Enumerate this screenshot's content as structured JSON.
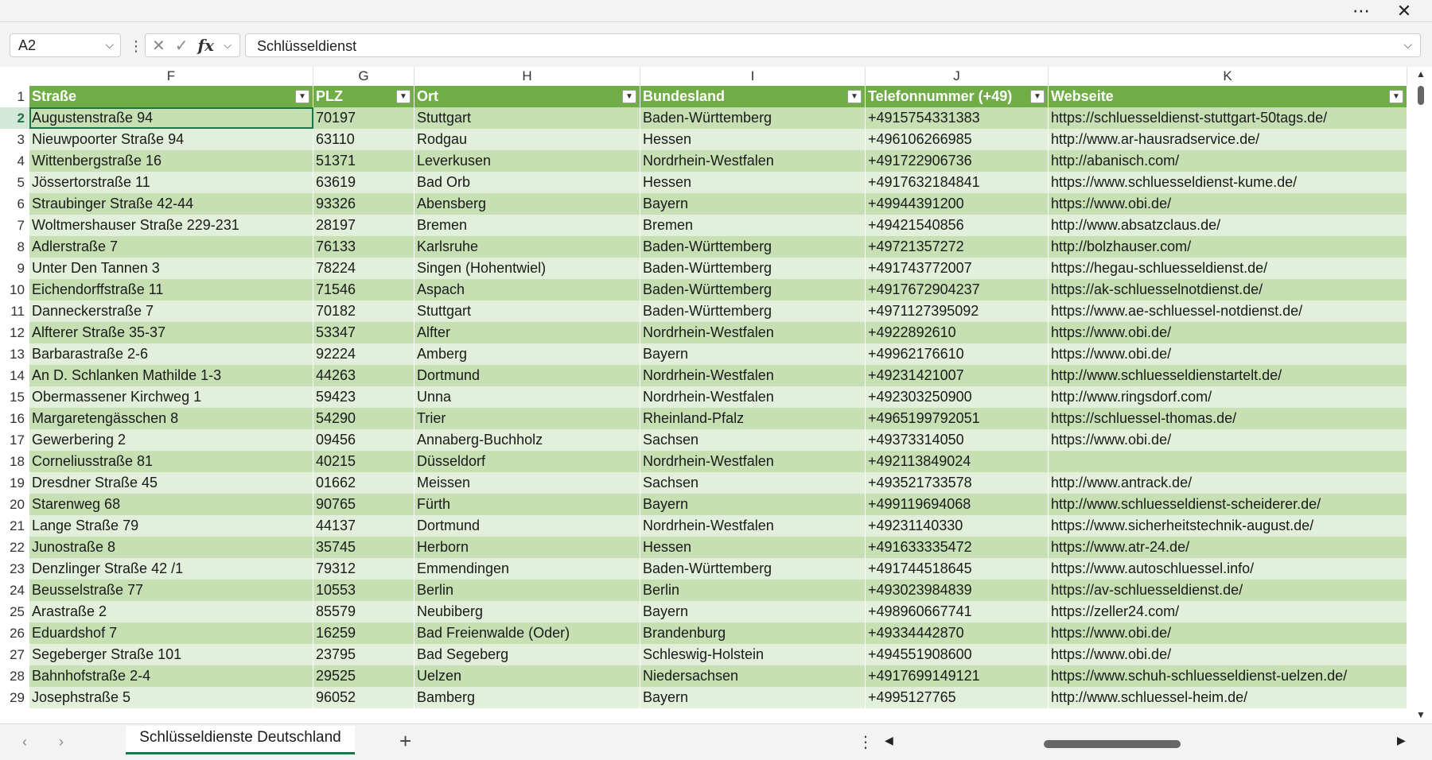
{
  "window": {
    "more_icon": "more-horizontal-icon",
    "close_icon": "close-icon"
  },
  "formula_bar": {
    "name_box": "A2",
    "formula_value": "Schlüsseldienst",
    "fx_label": "fx"
  },
  "columns": [
    "F",
    "G",
    "H",
    "I",
    "J",
    "K"
  ],
  "header_row_number": "1",
  "headers": [
    "Straße",
    "PLZ",
    "Ort",
    "Bundesland",
    "Telefonnummer (+49)",
    "Webseite"
  ],
  "rows": [
    {
      "n": "2",
      "cells": [
        "Augustenstraße 94",
        "70197",
        "Stuttgart",
        "Baden-Württemberg",
        "+4915754331383",
        "https://schluesseldienst-stuttgart-50tags.de/"
      ]
    },
    {
      "n": "3",
      "cells": [
        "Nieuwpoorter Straße 94",
        "63110",
        "Rodgau",
        "Hessen",
        "+496106266985",
        "http://www.ar-hausradservice.de/"
      ]
    },
    {
      "n": "4",
      "cells": [
        "Wittenbergstraße 16",
        "51371",
        "Leverkusen",
        "Nordrhein-Westfalen",
        "+491722906736",
        "http://abanisch.com/"
      ]
    },
    {
      "n": "5",
      "cells": [
        "Jössertorstraße 11",
        "63619",
        "Bad Orb",
        "Hessen",
        "+4917632184841",
        "https://www.schluesseldienst-kume.de/"
      ]
    },
    {
      "n": "6",
      "cells": [
        "Straubinger Straße 42-44",
        "93326",
        "Abensberg",
        "Bayern",
        "+49944391200",
        "https://www.obi.de/"
      ]
    },
    {
      "n": "7",
      "cells": [
        "Woltmershauser Straße 229-231",
        "28197",
        "Bremen",
        "Bremen",
        "+49421540856",
        "http://www.absatzclaus.de/"
      ]
    },
    {
      "n": "8",
      "cells": [
        "Adlerstraße 7",
        "76133",
        "Karlsruhe",
        "Baden-Württemberg",
        "+49721357272",
        "http://bolzhauser.com/"
      ]
    },
    {
      "n": "9",
      "cells": [
        "Unter Den Tannen 3",
        "78224",
        "Singen (Hohentwiel)",
        "Baden-Württemberg",
        "+491743772007",
        "https://hegau-schluesseldienst.de/"
      ]
    },
    {
      "n": "10",
      "cells": [
        "Eichendorffstraße 11",
        "71546",
        "Aspach",
        "Baden-Württemberg",
        "+4917672904237",
        "https://ak-schluesselnotdienst.de/"
      ]
    },
    {
      "n": "11",
      "cells": [
        "Danneckerstraße 7",
        "70182",
        "Stuttgart",
        "Baden-Württemberg",
        "+4971127395092",
        "https://www.ae-schluessel-notdienst.de/"
      ]
    },
    {
      "n": "12",
      "cells": [
        "Alfterer Straße 35-37",
        "53347",
        "Alfter",
        "Nordrhein-Westfalen",
        "+4922892610",
        "https://www.obi.de/"
      ]
    },
    {
      "n": "13",
      "cells": [
        "Barbarastraße 2-6",
        "92224",
        "Amberg",
        "Bayern",
        "+49962176610",
        "https://www.obi.de/"
      ]
    },
    {
      "n": "14",
      "cells": [
        "An D. Schlanken Mathilde 1-3",
        "44263",
        "Dortmund",
        "Nordrhein-Westfalen",
        "+49231421007",
        "http://www.schluesseldienstartelt.de/"
      ]
    },
    {
      "n": "15",
      "cells": [
        "Obermassener Kirchweg 1",
        "59423",
        "Unna",
        "Nordrhein-Westfalen",
        "+492303250900",
        "http://www.ringsdorf.com/"
      ]
    },
    {
      "n": "16",
      "cells": [
        "Margaretengässchen 8",
        "54290",
        "Trier",
        "Rheinland-Pfalz",
        "+4965199792051",
        "https://schluessel-thomas.de/"
      ]
    },
    {
      "n": "17",
      "cells": [
        "Gewerbering 2",
        "09456",
        "Annaberg-Buchholz",
        "Sachsen",
        "+49373314050",
        "https://www.obi.de/"
      ]
    },
    {
      "n": "18",
      "cells": [
        "Corneliusstraße 81",
        "40215",
        "Düsseldorf",
        "Nordrhein-Westfalen",
        "+492113849024",
        ""
      ]
    },
    {
      "n": "19",
      "cells": [
        "Dresdner Straße 45",
        "01662",
        "Meissen",
        "Sachsen",
        "+493521733578",
        "http://www.antrack.de/"
      ]
    },
    {
      "n": "20",
      "cells": [
        "Starenweg 68",
        "90765",
        "Fürth",
        "Bayern",
        "+499119694068",
        "http://www.schluesseldienst-scheiderer.de/"
      ]
    },
    {
      "n": "21",
      "cells": [
        "Lange Straße 79",
        "44137",
        "Dortmund",
        "Nordrhein-Westfalen",
        "+49231140330",
        "https://www.sicherheitstechnik-august.de/"
      ]
    },
    {
      "n": "22",
      "cells": [
        "Junostraße 8",
        "35745",
        "Herborn",
        "Hessen",
        "+491633335472",
        "https://www.atr-24.de/"
      ]
    },
    {
      "n": "23",
      "cells": [
        "Denzlinger Straße 42 /1",
        "79312",
        "Emmendingen",
        "Baden-Württemberg",
        "+491744518645",
        "https://www.autoschluessel.info/"
      ]
    },
    {
      "n": "24",
      "cells": [
        "Beusselstraße 77",
        "10553",
        "Berlin",
        "Berlin",
        "+493023984839",
        "https://av-schluesseldienst.de/"
      ]
    },
    {
      "n": "25",
      "cells": [
        "Arastraße 2",
        "85579",
        "Neubiberg",
        "Bayern",
        "+498960667741",
        "https://zeller24.com/"
      ]
    },
    {
      "n": "26",
      "cells": [
        "Eduardshof 7",
        "16259",
        "Bad Freienwalde (Oder)",
        "Brandenburg",
        "+49334442870",
        "https://www.obi.de/"
      ]
    },
    {
      "n": "27",
      "cells": [
        "Segeberger Straße 101",
        "23795",
        "Bad Segeberg",
        "Schleswig-Holstein",
        "+494551908600",
        "https://www.obi.de/"
      ]
    },
    {
      "n": "28",
      "cells": [
        "Bahnhofstraße 2-4",
        "29525",
        "Uelzen",
        "Niedersachsen",
        "+4917699149121",
        "https://www.schuh-schluesseldienst-uelzen.de/"
      ]
    },
    {
      "n": "29",
      "cells": [
        "Josephstraße 5",
        "96052",
        "Bamberg",
        "Bayern",
        "+4995127765",
        "http://www.schluessel-heim.de/"
      ]
    }
  ],
  "sheet_tab": "Schlüsseldienste Deutschland",
  "add_sheet": "+",
  "colors": {
    "header_green": "#70ad47",
    "band_light": "#e2efda",
    "band_dark": "#c6e0b4",
    "accent": "#217346"
  }
}
